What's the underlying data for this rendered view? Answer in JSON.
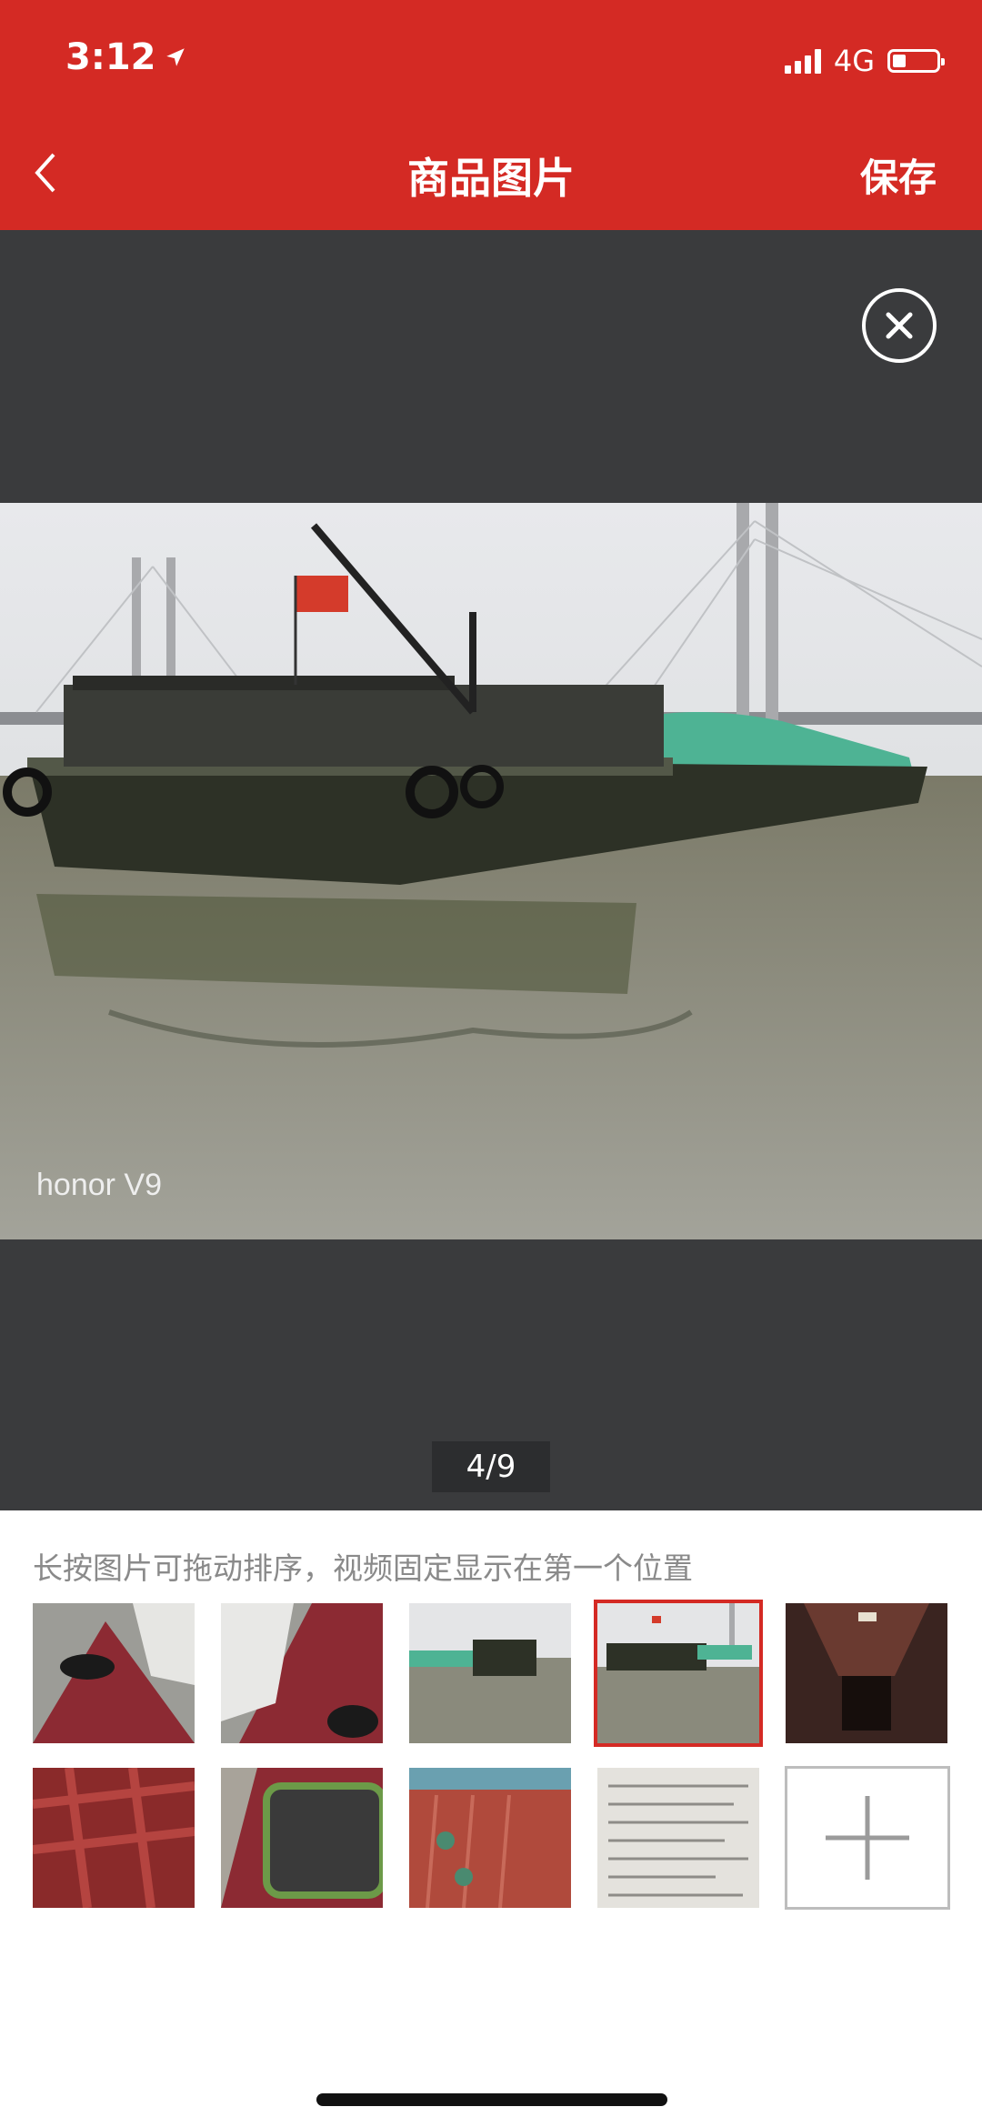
{
  "status_bar": {
    "time": "3:12",
    "network": "4G",
    "battery_level": 0.3
  },
  "nav": {
    "title": "商品图片",
    "save_label": "保存"
  },
  "viewer": {
    "counter": "4/9",
    "watermark": "honor V9"
  },
  "gallery": {
    "hint": "长按图片可拖动排序，视频固定显示在第一个位置",
    "thumbnails": [
      {
        "name": "deck-tire"
      },
      {
        "name": "deck-tarp"
      },
      {
        "name": "barge-far"
      },
      {
        "name": "barge-bridge"
      },
      {
        "name": "hold-interior"
      },
      {
        "name": "hold-frames"
      },
      {
        "name": "hold-coal"
      },
      {
        "name": "deck-valves"
      },
      {
        "name": "document"
      }
    ],
    "selected_index": 3
  },
  "colors": {
    "brand": "#d42a24",
    "viewer_bg": "#3a3b3d"
  }
}
